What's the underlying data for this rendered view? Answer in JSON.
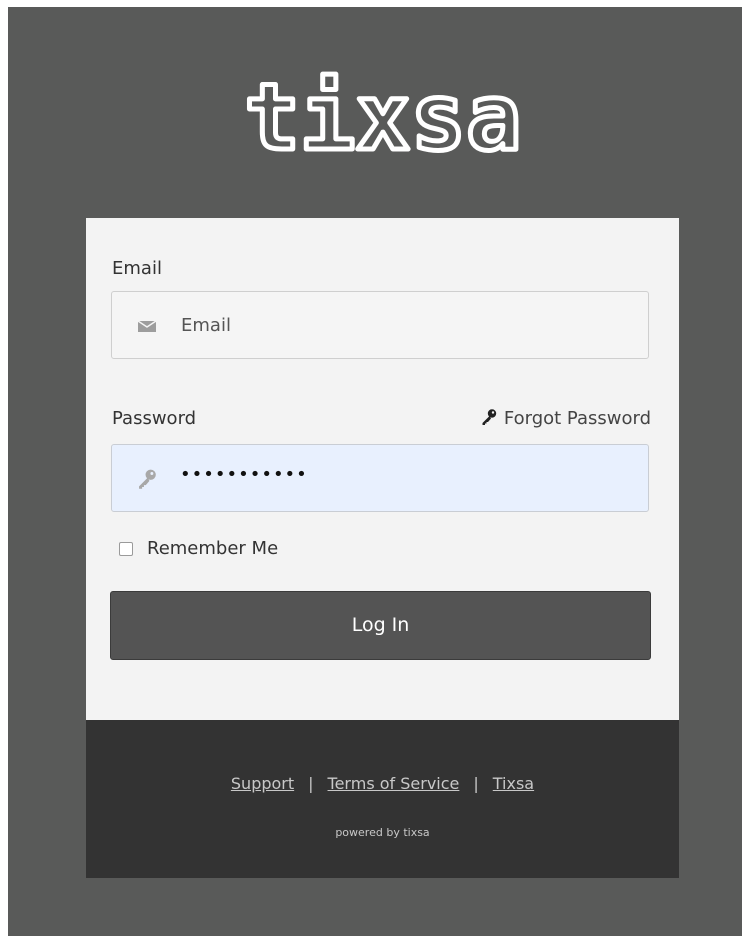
{
  "brand": {
    "logo_text": "tixsa",
    "logo_color": "#ffffff",
    "background_color": "#595a59"
  },
  "form": {
    "email_label": "Email",
    "email_placeholder": "Email",
    "email_icon": "envelope-icon",
    "password_label": "Password",
    "password_value": "•••••••••••",
    "password_icon": "key-icon",
    "forgot_password": "Forgot Password",
    "forgot_icon": "key-icon",
    "remember_me": "Remember Me",
    "remember_checked": false,
    "login_button": "Log In"
  },
  "footer": {
    "links": [
      "Support",
      "Terms of Service",
      "Tixsa"
    ],
    "separator": "|",
    "powered_by": "powered by tixsa"
  }
}
